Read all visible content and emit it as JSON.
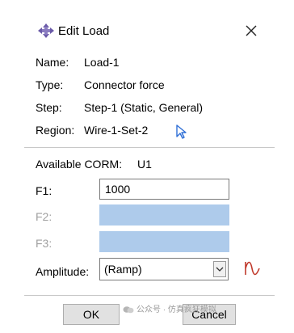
{
  "dialog": {
    "title": "Edit Load",
    "icons": {
      "title": "load-arrows-icon",
      "close": "close-icon"
    }
  },
  "info": {
    "name_label": "Name:",
    "name_value": "Load-1",
    "type_label": "Type:",
    "type_value": "Connector force",
    "step_label": "Step:",
    "step_value": "Step-1 (Static, General)",
    "region_label": "Region:",
    "region_value": "Wire-1-Set-2",
    "region_icon": "select-arrow-icon"
  },
  "corm": {
    "label": "Available CORM:",
    "value": "U1"
  },
  "fields": {
    "f1_label": "F1:",
    "f1_value": "1000",
    "f2_label": "F2:",
    "f2_value": "",
    "f3_label": "F3:",
    "f3_value": "",
    "disabled_fill": "#aecbeb"
  },
  "amplitude": {
    "label": "Amplitude:",
    "selected": "(Ramp)",
    "icon": "amplitude-curve-icon",
    "icon_color": "#c0392b"
  },
  "buttons": {
    "ok": "OK",
    "cancel": "Cancel"
  },
  "watermark": {
    "text": "公众号 · 仿真疯狂模拟"
  }
}
